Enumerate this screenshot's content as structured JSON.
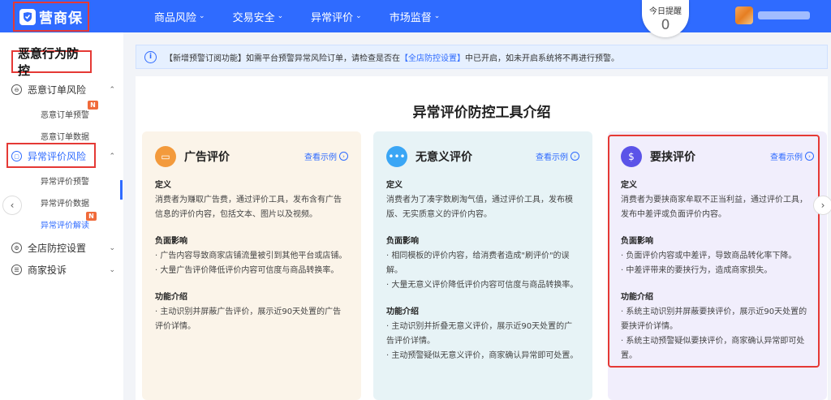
{
  "topbar": {
    "logo_text": "营商保",
    "nav": [
      {
        "label": "商品风险"
      },
      {
        "label": "交易安全"
      },
      {
        "label": "异常评价"
      },
      {
        "label": "市场监督"
      }
    ],
    "remind_label": "今日提醒",
    "remind_count": "0"
  },
  "sidebar": {
    "title": "恶意行为防控",
    "groups": [
      {
        "label": "恶意订单风险",
        "subs": [
          {
            "label": "恶意订单预警",
            "badge": "N"
          },
          {
            "label": "恶意订单数据"
          }
        ]
      },
      {
        "label": "异常评价风险",
        "subs": [
          {
            "label": "异常评价预警"
          },
          {
            "label": "异常评价数据"
          },
          {
            "label": "异常评价解读",
            "badge": "N"
          }
        ]
      },
      {
        "label": "全店防控设置"
      },
      {
        "label": "商家投诉"
      }
    ]
  },
  "notice": {
    "pre": "【新增预警订阅功能】如需平台预警异常风险订单，请检查是否在",
    "link": "【全店防控设置】",
    "post": "中已开启，如未开启系统将不再进行预警。"
  },
  "main": {
    "title": "异常评价防控工具介绍",
    "view_example": "查看示例",
    "cards": [
      {
        "title": "广告评价",
        "icon": "ad-icon",
        "def_title": "定义",
        "def_text": "消费者为赚取广告费，通过评价工具，发布含有广告信息的评价内容，包括文本、图片以及视频。",
        "impact_title": "负面影响",
        "impact_text_1": "· 广告内容导致商家店铺流量被引到其他平台或店铺。",
        "impact_text_2": "· 大量广告评价降低评价内容可信度与商品转换率。",
        "feature_title": "功能介绍",
        "feature_text_1": "· 主动识别并屏蔽广告评价，展示近90天处置的广告评价详情。"
      },
      {
        "title": "无意义评价",
        "icon": "chat-icon",
        "def_title": "定义",
        "def_text": "消费者为了凑字数刷淘气值，通过评价工具，发布模版、无实质意义的评价内容。",
        "impact_title": "负面影响",
        "impact_text_1": "· 相同模板的评价内容，给消费者造成\"刷评价\"的误解。",
        "impact_text_2": "· 大量无意义评价降低评价内容可信度与商品转换率。",
        "feature_title": "功能介绍",
        "feature_text_1": "· 主动识别并折叠无意义评价，展示近90天处置的广告评价详情。",
        "feature_text_2": "· 主动预警疑似无意义评价，商家确认异常即可处置。"
      },
      {
        "title": "要挟评价",
        "icon": "money-bag-icon",
        "def_title": "定义",
        "def_text": "消费者为要挟商家牟取不正当利益，通过评价工具，发布中差评或负面评价内容。",
        "impact_title": "负面影响",
        "impact_text_1": "· 负面评价内容或中差评，导致商品转化率下降。",
        "impact_text_2": "· 中差评带来的要挟行为，造成商家损失。",
        "feature_title": "功能介绍",
        "feature_text_1": "· 系统主动识别并屏蔽要挟评价，展示近90天处置的要挟评价详情。",
        "feature_text_2": "· 系统主动预警疑似要挟评价，商家确认异常即可处置。"
      }
    ]
  },
  "colors": {
    "primary": "#2f6bff",
    "highlight": "#e53935",
    "badge": "#f06a3a"
  }
}
